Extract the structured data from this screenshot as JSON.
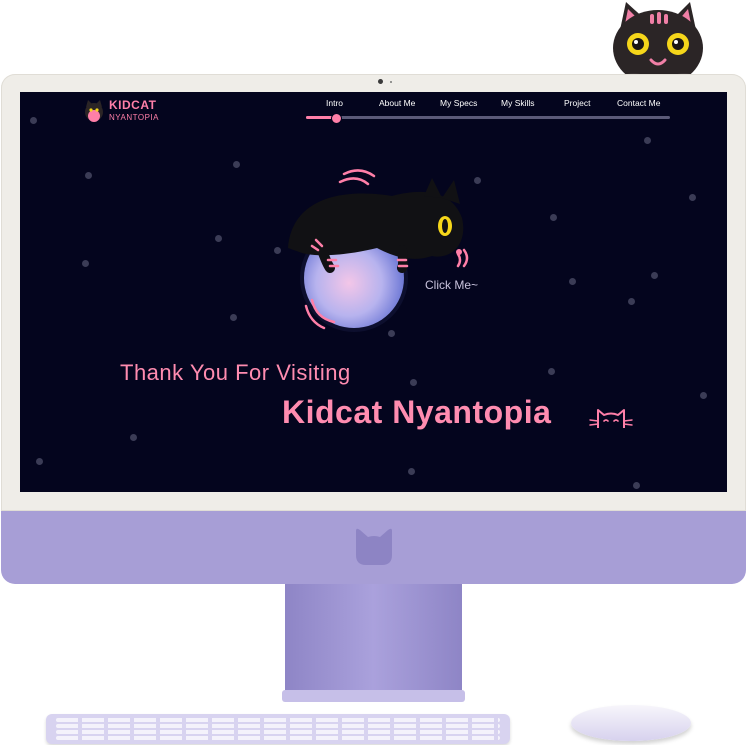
{
  "brand": {
    "title": "KIDCAT",
    "subtitle": "NYANTOPIA"
  },
  "nav": {
    "items": [
      {
        "label": "Intro"
      },
      {
        "label": "About Me"
      },
      {
        "label": "My Specs"
      },
      {
        "label": "My Skills"
      },
      {
        "label": "Project"
      },
      {
        "label": "Contact Me"
      }
    ],
    "progress": 0.08
  },
  "hero": {
    "click_label": "Click Me~"
  },
  "closing": {
    "thanks": "Thank You For Visiting",
    "name": "Kidcat Nyantopia"
  },
  "colors": {
    "accent": "#ff7fa8",
    "screen_bg": "#04051e",
    "monitor_purple": "#a79ed6"
  },
  "icons": [
    "cat-logo-icon",
    "paw-icon",
    "cat-face-icon",
    "apple-cat-icon"
  ]
}
